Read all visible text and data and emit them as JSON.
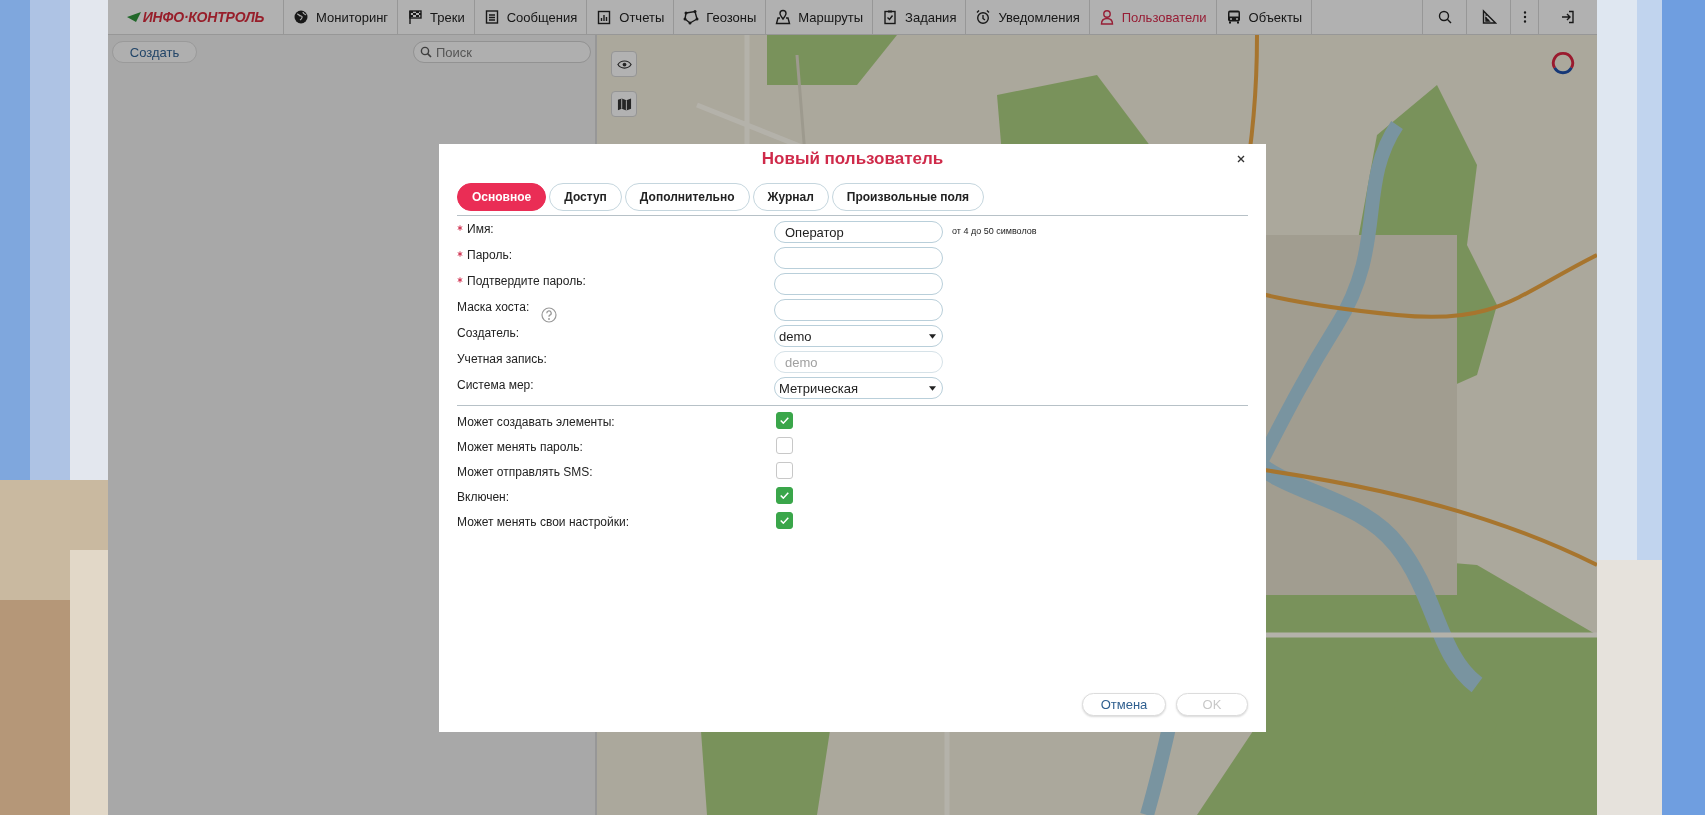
{
  "logo": {
    "text": "ИНФО·КОНТРОЛЬ"
  },
  "nav": [
    {
      "label": "Мониторинг",
      "selected": false
    },
    {
      "label": "Треки",
      "selected": false
    },
    {
      "label": "Сообщения",
      "selected": false
    },
    {
      "label": "Отчеты",
      "selected": false
    },
    {
      "label": "Геозоны",
      "selected": false
    },
    {
      "label": "Маршруты",
      "selected": false
    },
    {
      "label": "Задания",
      "selected": false
    },
    {
      "label": "Уведомления",
      "selected": false
    },
    {
      "label": "Пользователи",
      "selected": true
    },
    {
      "label": "Объекты",
      "selected": false
    }
  ],
  "left_panel": {
    "create_button": "Создать",
    "search": {
      "placeholder": "Поиск"
    }
  },
  "dialog": {
    "title": "Новый пользователь",
    "tabs": [
      {
        "label": "Основное",
        "selected": true
      },
      {
        "label": "Доступ",
        "selected": false
      },
      {
        "label": "Дополнительно",
        "selected": false
      },
      {
        "label": "Журнал",
        "selected": false
      },
      {
        "label": "Произвольные поля",
        "selected": false
      }
    ],
    "fields": [
      {
        "label": "Имя:",
        "required": true,
        "kind": "text",
        "value": "Оператор",
        "hint": "от 4 до 50 символов"
      },
      {
        "label": "Пароль:",
        "required": true,
        "kind": "text"
      },
      {
        "label": "Подтвердите пароль:",
        "required": true,
        "kind": "text"
      },
      {
        "label": "Маска хоста:",
        "required": false,
        "kind": "text",
        "help": true
      },
      {
        "label": "Создатель:",
        "required": false,
        "kind": "select",
        "value": "demo"
      },
      {
        "label": "Учетная запись:",
        "required": false,
        "kind": "text",
        "placeholder": "demo",
        "disabled": true
      },
      {
        "label": "Система мер:",
        "required": false,
        "kind": "select",
        "value": "Метрическая"
      }
    ],
    "checkboxes": [
      {
        "label": "Может создавать элементы:",
        "checked": true
      },
      {
        "label": "Может менять пароль:",
        "checked": false
      },
      {
        "label": "Может отправлять SMS:",
        "checked": false
      },
      {
        "label": "Включен:",
        "checked": true
      },
      {
        "label": "Может менять свои настройки:",
        "checked": true
      }
    ],
    "buttons": [
      {
        "label": "Отмена",
        "disabled": false
      },
      {
        "label": "OK",
        "disabled": true
      }
    ]
  }
}
